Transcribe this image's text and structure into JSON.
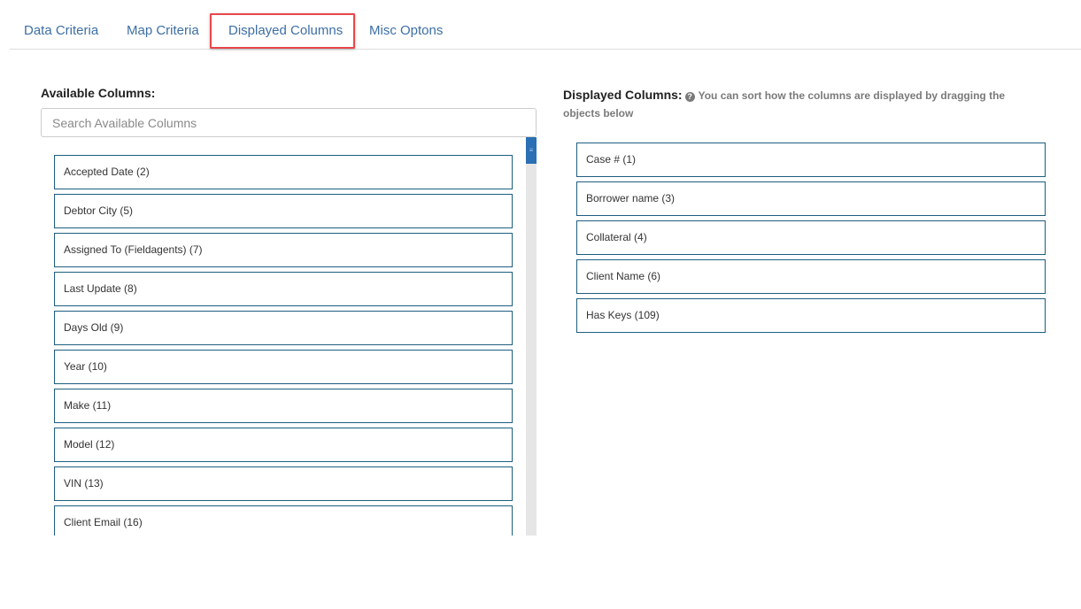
{
  "tabs": {
    "data_criteria": "Data Criteria",
    "map_criteria": "Map Criteria",
    "displayed_columns": "Displayed Columns",
    "misc_options": "Misc Optons"
  },
  "available": {
    "title": "Available Columns:",
    "search_placeholder": "Search Available Columns",
    "items": [
      "Accepted Date (2)",
      "Debtor City (5)",
      "Assigned To (Fieldagents) (7)",
      "Last Update (8)",
      "Days Old (9)",
      "Year (10)",
      "Make (11)",
      "Model (12)",
      "VIN (13)",
      "Client Email (16)"
    ]
  },
  "displayed": {
    "title": "Displayed Columns:",
    "help_icon": "question-circle-icon",
    "hint": "You can sort how the columns are displayed by dragging the objects below",
    "items": [
      "Case # (1)",
      "Borrower name (3)",
      "Collateral (4)",
      "Client Name (6)",
      "Has Keys (109)"
    ]
  },
  "colors": {
    "tab_text": "#3d6fa5",
    "highlight": "#e8474a",
    "item_border": "#1e5e80",
    "scroll_thumb": "#2b6fb5"
  }
}
